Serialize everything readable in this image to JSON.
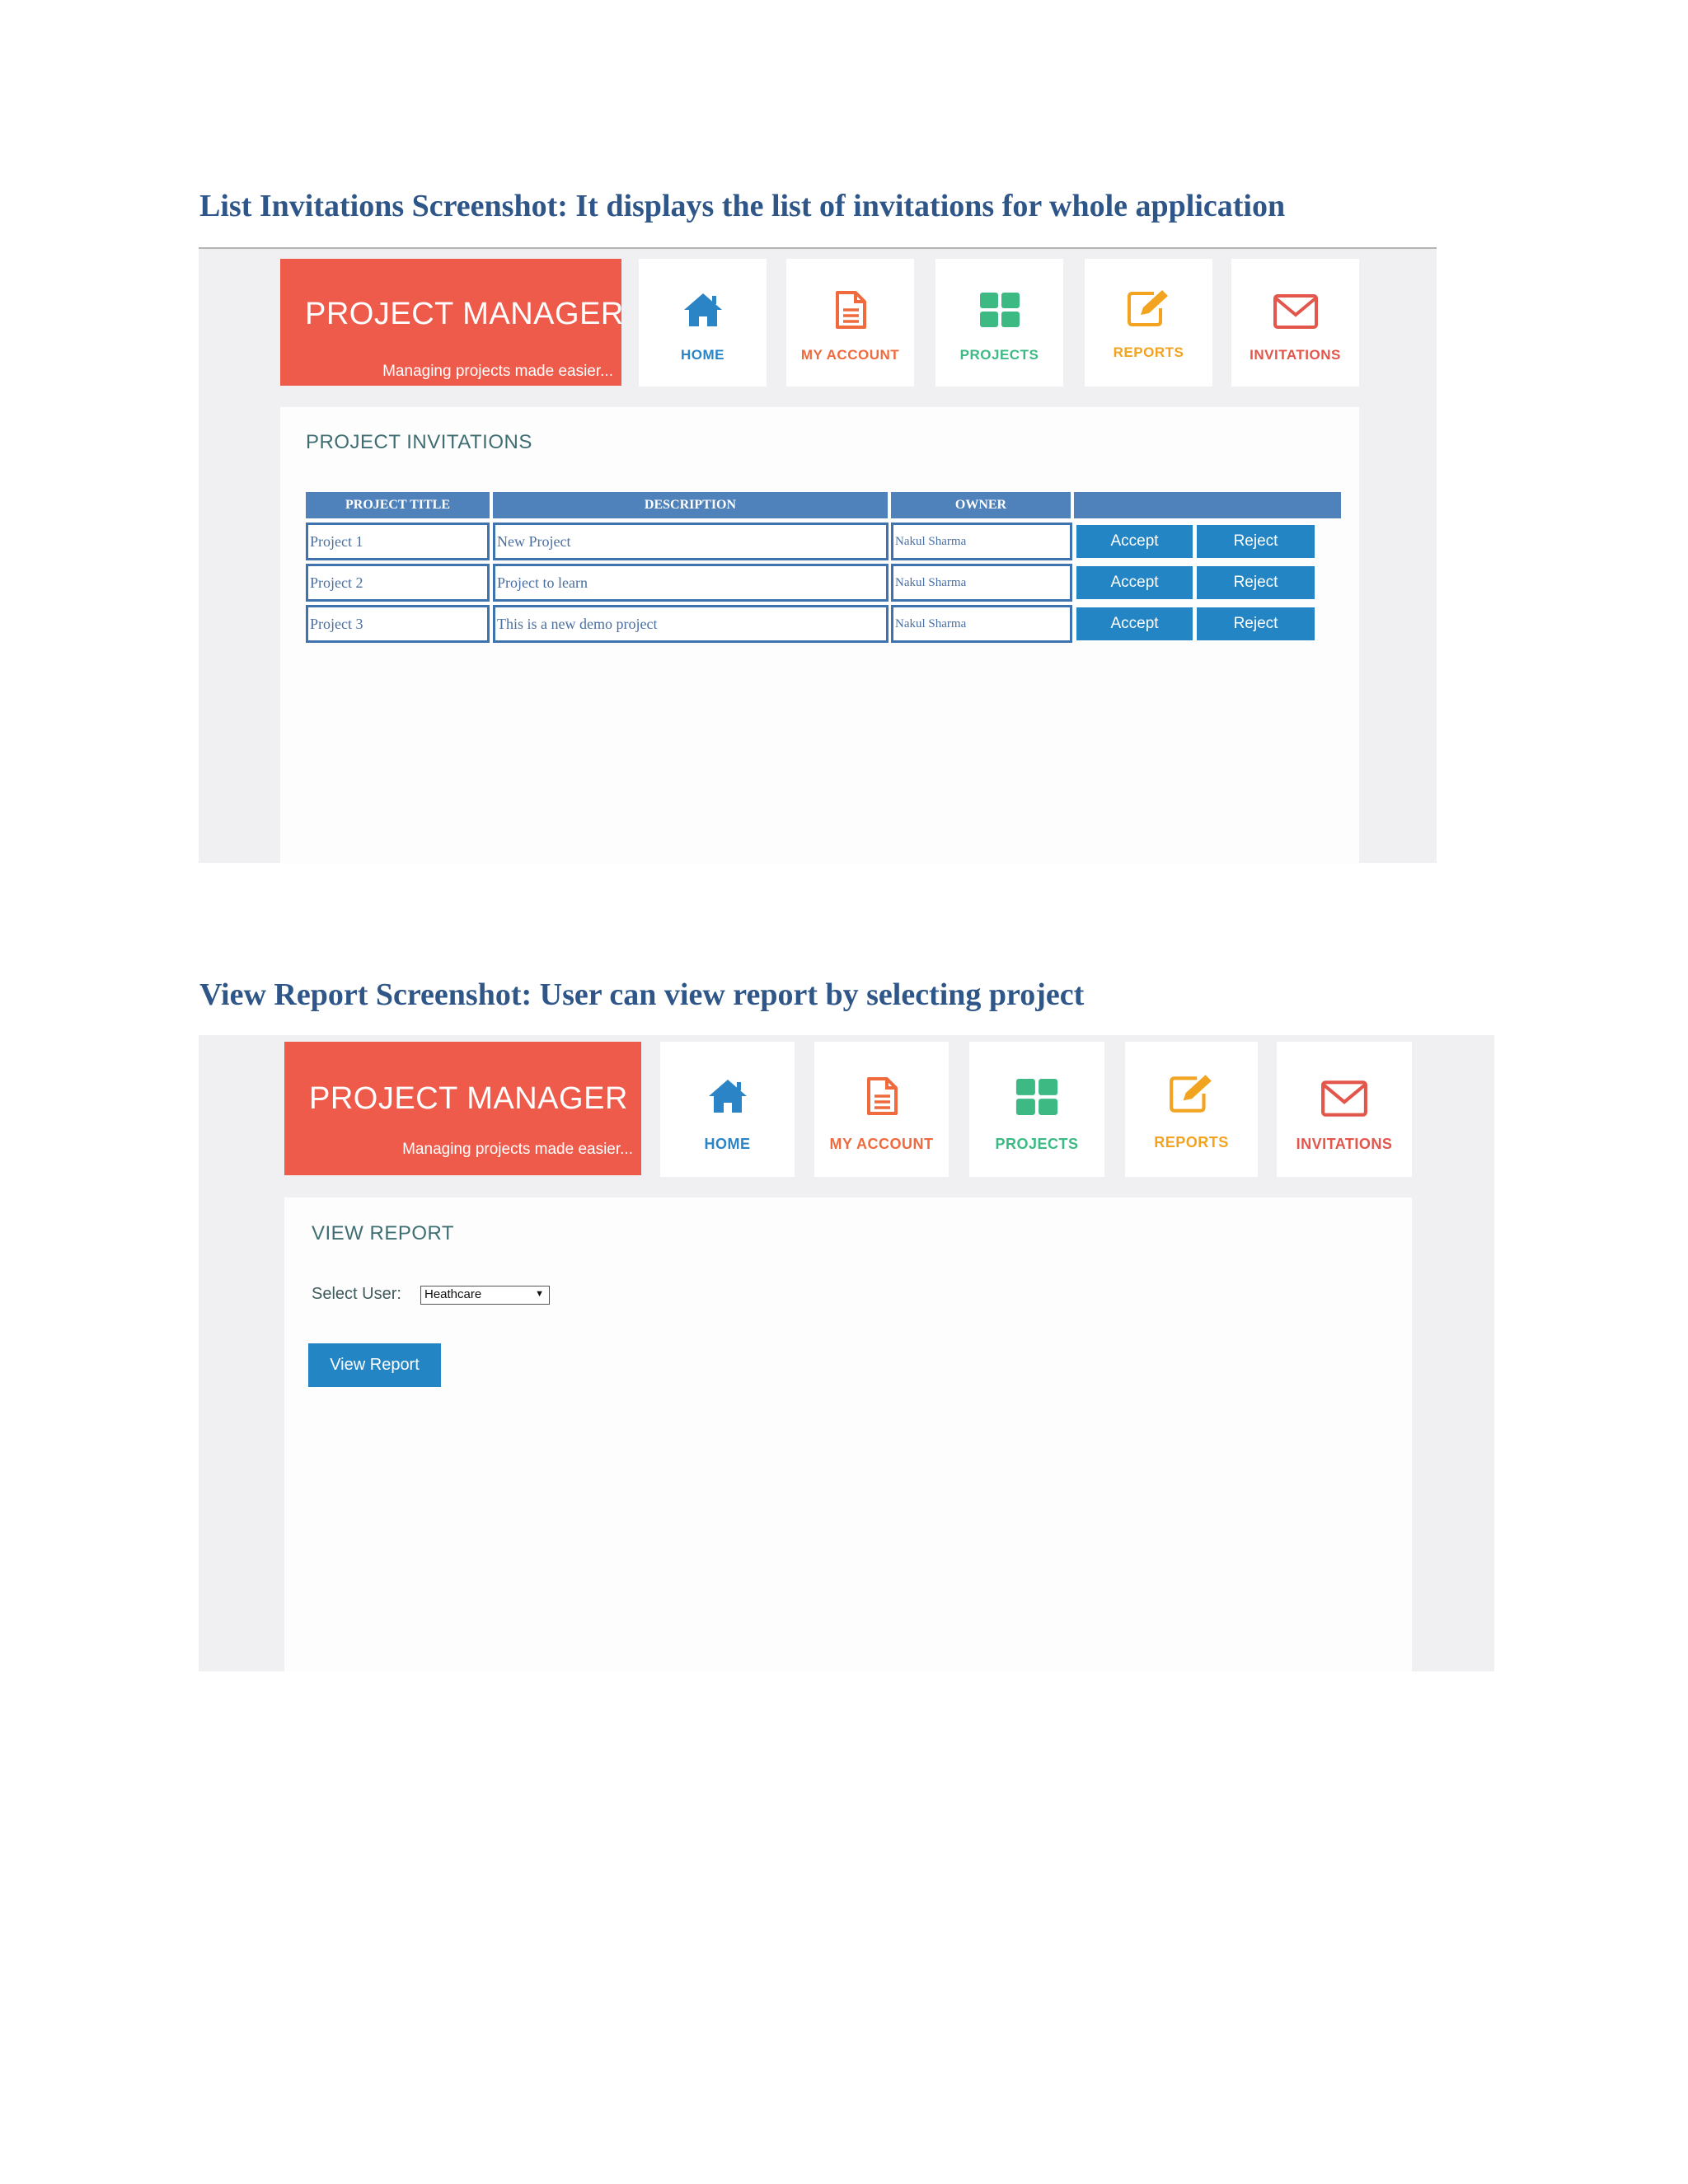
{
  "section1": {
    "heading": "List Invitations Screenshot: It displays the list of invitations for whole application",
    "app": {
      "brand_title": "PROJECT MANAGER",
      "brand_tagline": "Managing projects made easier...",
      "nav": [
        {
          "label": "HOME",
          "icon": "home-icon",
          "color": "#2a84c5"
        },
        {
          "label": "MY ACCOUNT",
          "icon": "document-icon",
          "color": "#ef6a3d"
        },
        {
          "label": "PROJECTS",
          "icon": "grid-icon",
          "color": "#3dba84"
        },
        {
          "label": "REPORTS",
          "icon": "edit-icon",
          "color": "#f2a31f"
        },
        {
          "label": "INVITATIONS",
          "icon": "envelope-icon",
          "color": "#e2564b"
        }
      ],
      "page_title": "PROJECT INVITATIONS",
      "table": {
        "headers": [
          "PROJECT TITLE",
          "DESCRIPTION",
          "OWNER",
          ""
        ],
        "rows": [
          {
            "title": "Project 1",
            "description": "New Project",
            "owner": "Nakul Sharma",
            "accept": "Accept",
            "reject": "Reject"
          },
          {
            "title": "Project 2",
            "description": "Project to learn",
            "owner": "Nakul Sharma",
            "accept": "Accept",
            "reject": "Reject"
          },
          {
            "title": "Project 3",
            "description": "This is a new demo project",
            "owner": "Nakul Sharma",
            "accept": "Accept",
            "reject": "Reject"
          }
        ]
      }
    }
  },
  "section2": {
    "heading": "View Report Screenshot: User can view report by selecting project",
    "app": {
      "brand_title": "PROJECT MANAGER",
      "brand_tagline": "Managing projects made easier...",
      "nav": [
        {
          "label": "HOME",
          "icon": "home-icon",
          "color": "#2a84c5"
        },
        {
          "label": "MY ACCOUNT",
          "icon": "document-icon",
          "color": "#ef6a3d"
        },
        {
          "label": "PROJECTS",
          "icon": "grid-icon",
          "color": "#3dba84"
        },
        {
          "label": "REPORTS",
          "icon": "edit-icon",
          "color": "#f2a31f"
        },
        {
          "label": "INVITATIONS",
          "icon": "envelope-icon",
          "color": "#e2564b"
        }
      ],
      "page_title": "VIEW REPORT",
      "select_label": "Select User:",
      "select_value": "Heathcare",
      "view_button": "View Report"
    }
  },
  "colors": {
    "brand": "#ef5b4b",
    "button": "#2485c4",
    "table_header": "#4f82ba",
    "heading": "#2f5688"
  }
}
